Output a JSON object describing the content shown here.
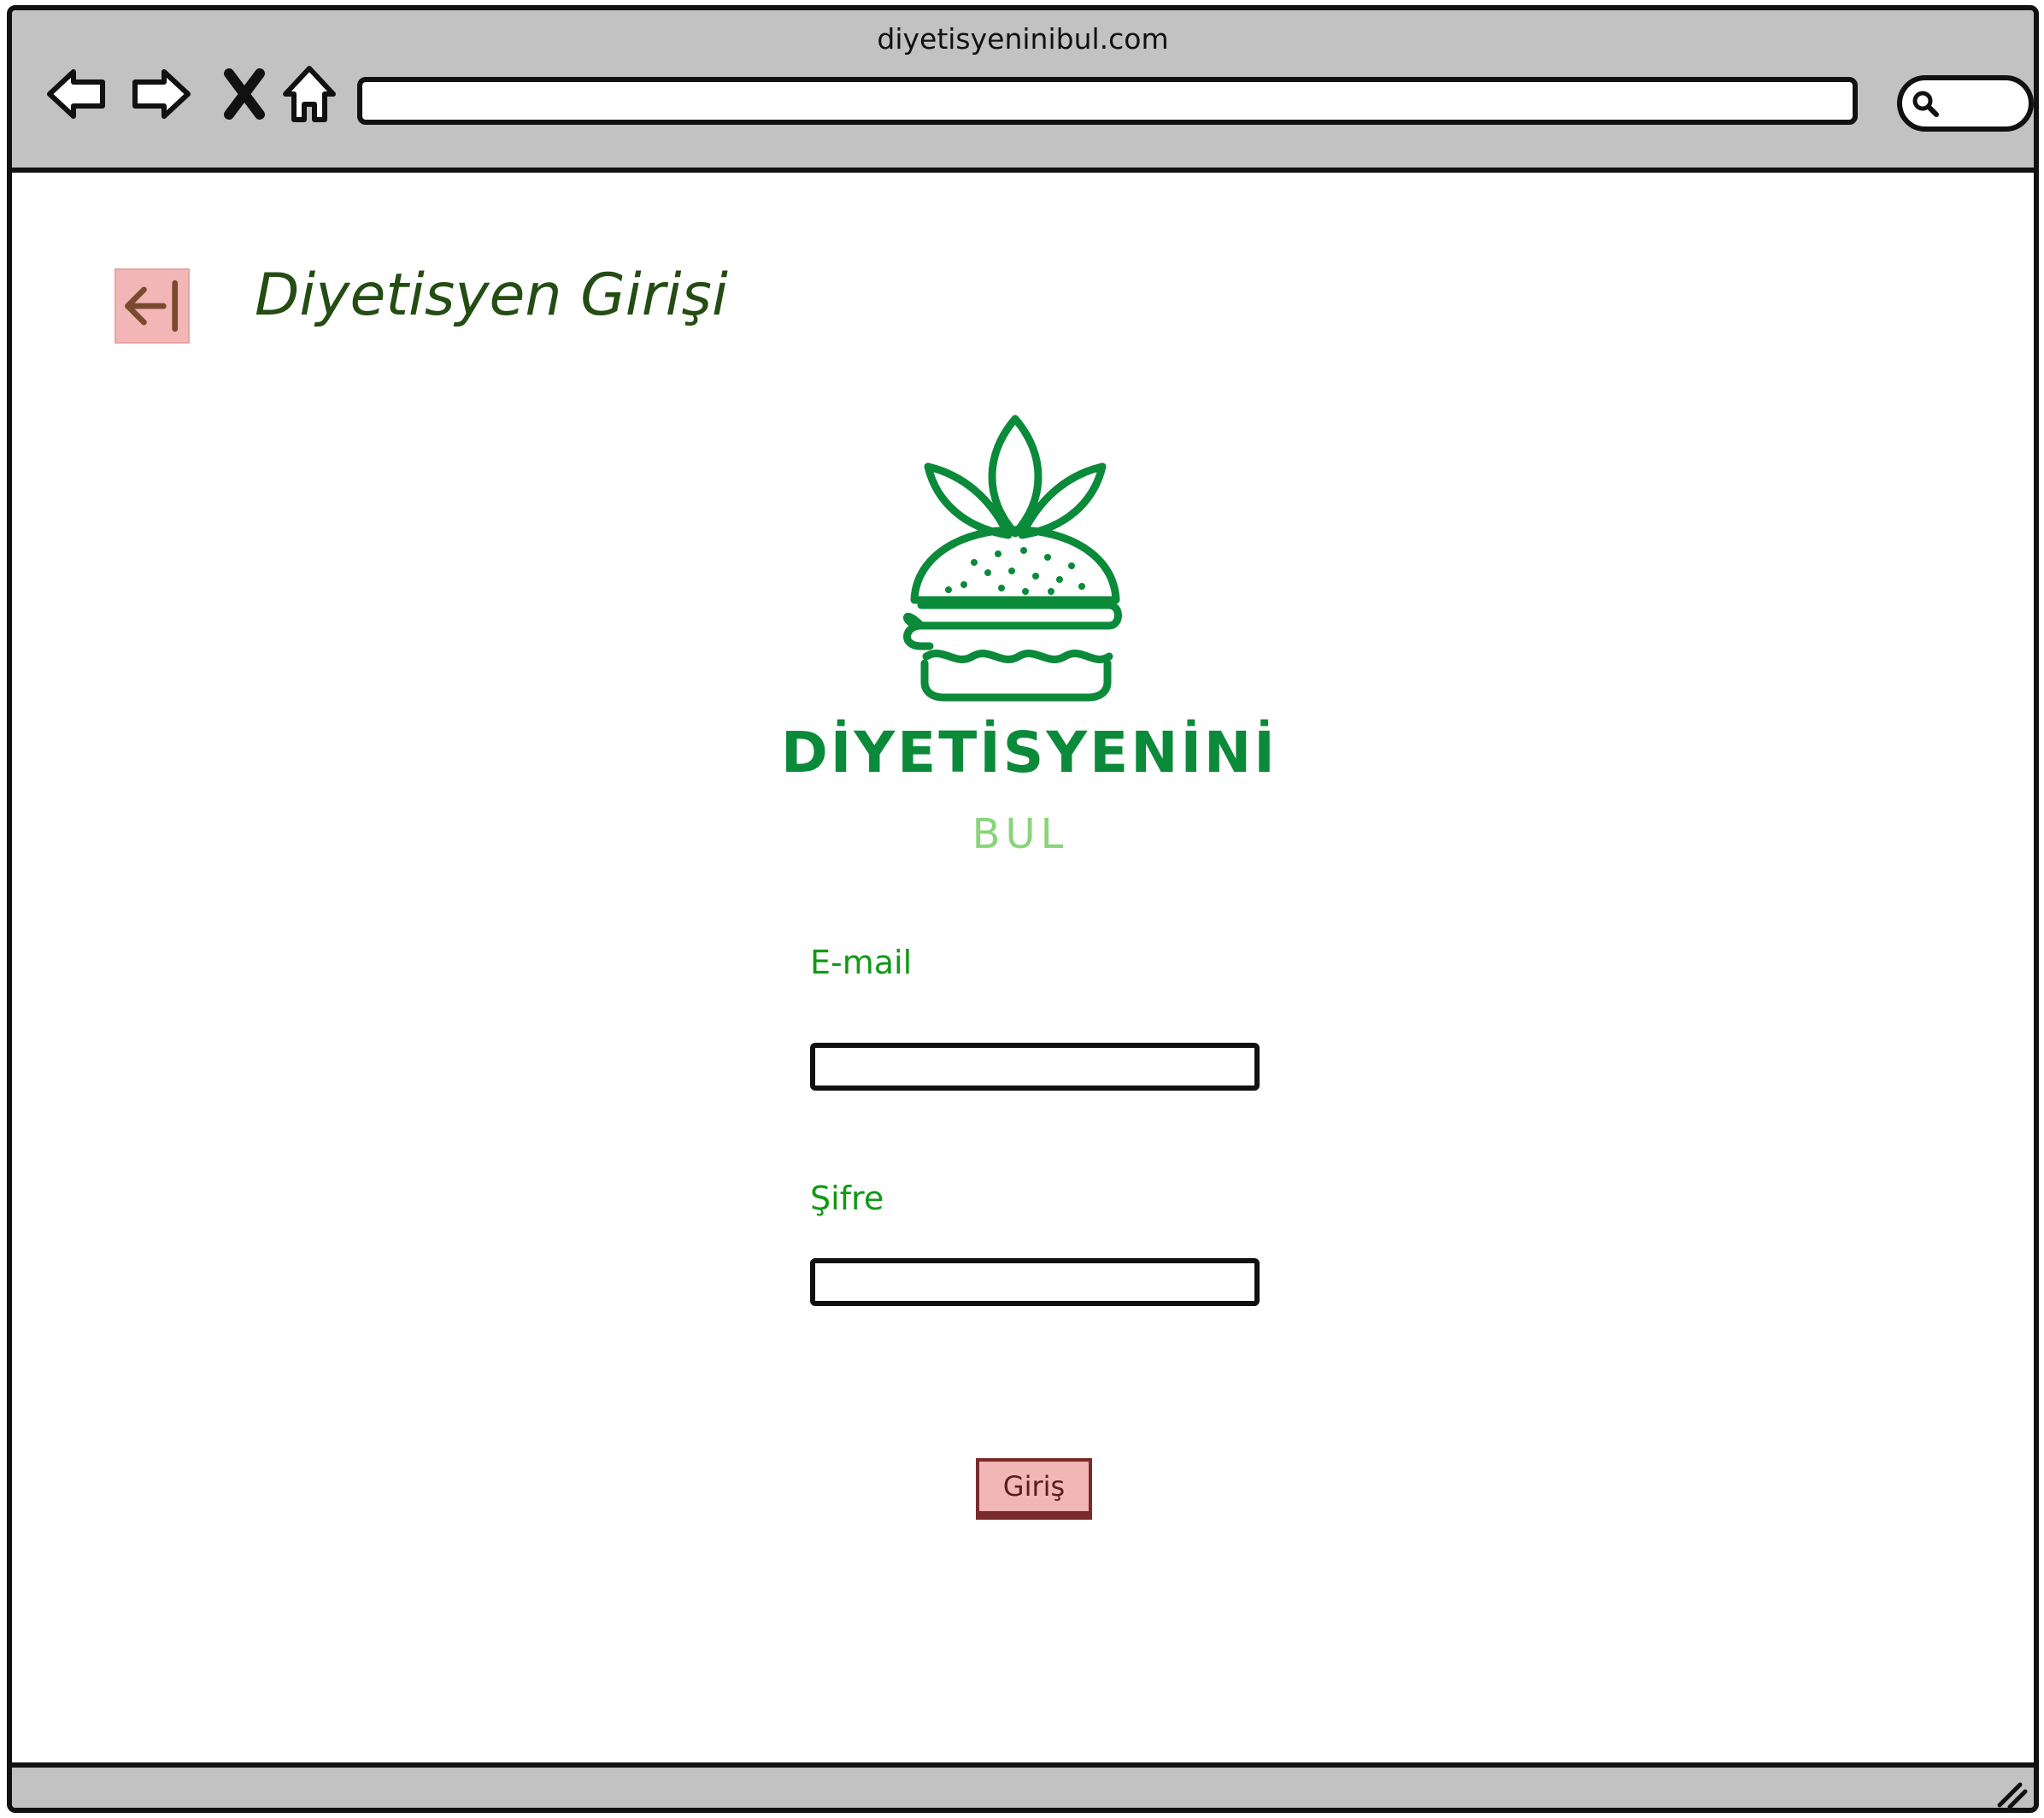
{
  "browser": {
    "site_title": "diyetisyeninibul.com",
    "address_value": "",
    "search_value": ""
  },
  "page": {
    "title": "Diyetisyen Girişi"
  },
  "logo": {
    "wordmark": "DİYETİSYENİNİ",
    "subtext": "BUL",
    "brand_green": "#0b8a3a",
    "light_green": "#8ad47a"
  },
  "form": {
    "email_label": "E-mail",
    "email_value": "",
    "password_label": "Şifre",
    "password_value": "",
    "submit_label": "Giriş"
  },
  "colors": {
    "title_green": "#234d12",
    "label_green": "#0f9a14",
    "button_pink": "#f2b6b6",
    "button_border": "#7a2a2a",
    "chrome_gray": "#c2c2c2"
  },
  "icons": {
    "back": "back-arrow-icon",
    "forward": "forward-arrow-icon",
    "stop": "close-icon",
    "home": "home-icon",
    "search": "search-icon",
    "page_back": "arrow-left-bar-icon"
  }
}
